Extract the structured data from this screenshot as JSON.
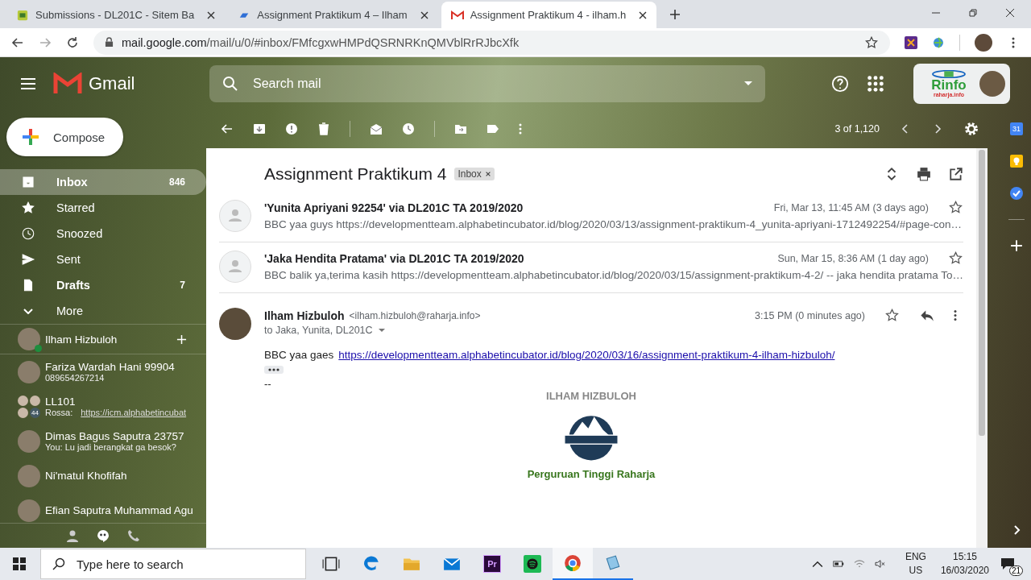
{
  "browser": {
    "tabs": [
      {
        "title": "Submissions - DL201C - Sitem Ba",
        "kind": "site",
        "selected": false
      },
      {
        "title": "Assignment Praktikum 4 – Ilham",
        "kind": "blog",
        "selected": false
      },
      {
        "title": "Assignment Praktikum 4 - ilham.h",
        "kind": "gmail",
        "selected": true
      }
    ],
    "url_host": "mail.google.com",
    "url_path": "/mail/u/0/#inbox/FMfcgxwHMPdQSRNRKnQMVblRrRJbcXfk"
  },
  "gmail": {
    "brand": "Gmail",
    "search": {
      "placeholder": "Search mail"
    },
    "account": {
      "logo_text": "Rinfo",
      "logo_sub": "raharja.info"
    },
    "compose": "Compose",
    "nav": [
      {
        "label": "Inbox",
        "kind": "inbox",
        "count": "846",
        "selected": true
      },
      {
        "label": "Starred",
        "kind": "star",
        "selected": false
      },
      {
        "label": "Snoozed",
        "kind": "clock",
        "selected": false
      },
      {
        "label": "Sent",
        "kind": "send",
        "selected": false
      },
      {
        "label": "Drafts",
        "kind": "draft",
        "count": "7",
        "selected": false
      }
    ],
    "more": "More",
    "chat_user": {
      "name": "Ilham Hizbuloh",
      "online": true
    },
    "chats": [
      {
        "name": "Fariza Wardah Hani 99904",
        "preview": "089654267214",
        "kind": "person"
      },
      {
        "name": "LL101",
        "preview": "Rossa:",
        "link": "https://icm.alphabetincubat",
        "members_badge": "44",
        "kind": "group"
      },
      {
        "name": "Dimas Bagus Saputra 23757",
        "preview": "You: Lu jadi berangkat ga besok?",
        "kind": "person"
      },
      {
        "name": "Ni'matul Khofifah",
        "kind": "person"
      },
      {
        "name": "Efian Saputra Muhammad Agu",
        "kind": "person"
      }
    ],
    "pager": "3 of 1,120",
    "side_panel": {
      "calendar_day": "31"
    },
    "thread": {
      "subject": "Assignment Praktikum 4",
      "label": "Inbox",
      "collapsed": [
        {
          "sender": "'Yunita Apriyani 92254' via DL201C TA 2019/2020",
          "date": "Fri, Mar 13, 11:45 AM (3 days ago)",
          "snippet": "BBC yaa guys https://developmentteam.alphabetincubator.id/blog/2020/03/13/assignment-praktikum-4_yunita-apriyani-1712492254/#page-con…",
          "starred": false
        },
        {
          "sender": "'Jaka Hendita Pratama' via DL201C TA 2019/2020",
          "date": "Sun, Mar 15, 8:36 AM (1 day ago)",
          "snippet": "BBC balik ya,terima kasih https://developmentteam.alphabetincubator.id/blog/2020/03/15/assignment-praktikum-4-2/ -- jaka hendita pratama To…",
          "starred": false
        }
      ],
      "open": {
        "sender": "Ilham Hizbuloh",
        "email": "<ilham.hizbuloh@raharja.info>",
        "date": "3:15 PM (0 minutes ago)",
        "starred": false,
        "to": "to Jaka, Yunita, DL201C",
        "body": "BBC yaa gaes",
        "link": "https://developmentteam.alphabetincubator.id/blog/2020/03/16/assignment-praktikum-4-ilham-hizbuloh/",
        "sig_dash": "--",
        "sig_name": "ILHAM HIZBULOH",
        "sig_org": "Perguruan Tinggi Raharja"
      }
    }
  },
  "taskbar": {
    "search_placeholder": "Type here to search",
    "apps": [
      {
        "kind": "taskview",
        "running": false,
        "selected": false
      },
      {
        "kind": "edge",
        "running": false,
        "selected": false
      },
      {
        "kind": "explorer",
        "running": false,
        "selected": false
      },
      {
        "kind": "mail",
        "running": false,
        "selected": false
      },
      {
        "kind": "premiere",
        "label": "Pr",
        "running": false,
        "selected": false
      },
      {
        "kind": "spotify",
        "running": false,
        "selected": false
      },
      {
        "kind": "chrome",
        "running": true,
        "selected": true
      },
      {
        "kind": "notepad",
        "running": true,
        "selected": false
      }
    ],
    "lang": "ENG",
    "region": "US",
    "time": "15:15",
    "date": "16/03/2020",
    "notifications": "21"
  }
}
